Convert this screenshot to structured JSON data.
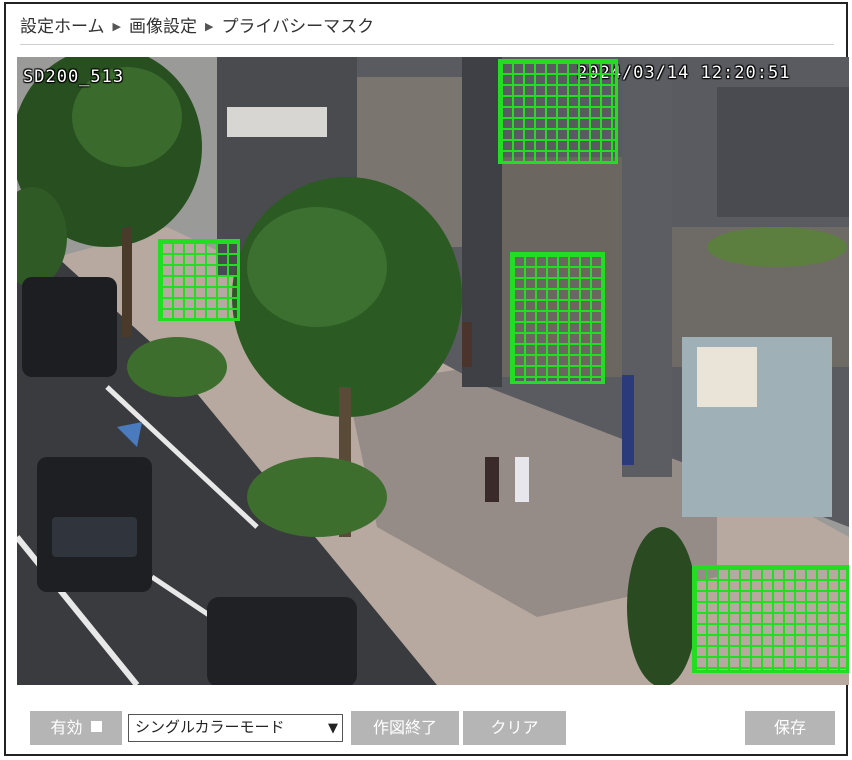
{
  "breadcrumb": {
    "items": [
      "設定ホーム",
      "画像設定",
      "プライバシーマスク"
    ],
    "separator": "▶"
  },
  "video": {
    "osd_name": "SD200_513",
    "osd_datetime": "2024/03/14 12:20:51",
    "mask_color": "#22dd22",
    "mask_count": 4
  },
  "toolbar": {
    "enable_label": "有効",
    "mode_select_value": "シングルカラーモード",
    "draw_end_label": "作図終了",
    "clear_label": "クリア",
    "save_label": "保存"
  }
}
